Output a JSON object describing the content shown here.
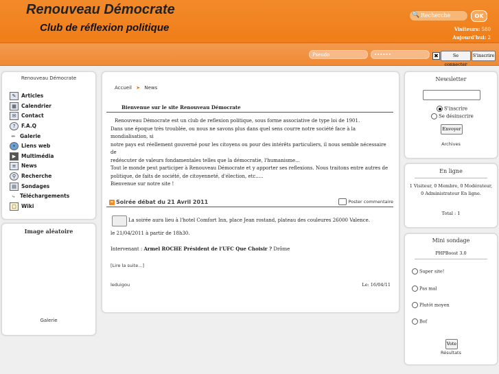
{
  "header": {
    "title": "Renouveau Démocrate",
    "subtitle": "Club de réflexion politique",
    "search_placeholder": "Recherche",
    "ok_label": "OK",
    "visitors_label": "Visiteurs:",
    "visitors_value": "580",
    "today_label": "Aujourd'hui:",
    "today_value": "2"
  },
  "login": {
    "pseudo_placeholder": "Pseudo",
    "password_value": "••••••",
    "connect_label": "Se connecter",
    "register_label": "S'inscrire"
  },
  "left": {
    "title": "Renouveau Démocrate",
    "menu": [
      {
        "label": "Articles",
        "icon": "articles-icon"
      },
      {
        "label": "Calendrier",
        "icon": "calendar-icon"
      },
      {
        "label": "Contact",
        "icon": "contact-icon"
      },
      {
        "label": "F.A.Q",
        "icon": "faq-icon"
      },
      {
        "label": "Galerie",
        "icon": "gallery-icon"
      },
      {
        "label": "Liens web",
        "icon": "web-links-icon"
      },
      {
        "label": "Multimédia",
        "icon": "multimedia-icon"
      },
      {
        "label": "News",
        "icon": "news-icon"
      },
      {
        "label": "Recherche",
        "icon": "search-icon"
      },
      {
        "label": "Sondages",
        "icon": "polls-icon"
      },
      {
        "label": "Téléchargements",
        "icon": "downloads-icon"
      },
      {
        "label": "Wiki",
        "icon": "wiki-icon"
      }
    ],
    "random_image_title": "Image aléatoire",
    "gallery_link": "Galerie"
  },
  "main": {
    "breadcrumb": [
      "Accueil",
      "News"
    ],
    "welcome_title": "Bienvenue sur le site Renouveau Démocrate",
    "welcome_lines": [
      "Renouveau Démocrate est un club de reflexion politique, sous forme associative de type loi de 1901.",
      "Dans une époque très troublée, ou nous ne savons plus dans quel sens courre notre société face à la mondialisation, si",
      "notre pays est réellement gouverné pour les citoyens ou pour des intérêts particuliers, il nous semble nécessaire de",
      "redéscuter de valeurs fondamentales telles que la démocratie, l'humanisme...",
      "Tout le monde peut participer à Renouveau Démocrate et y apporter ses reflexions. Nous traitons entre autres de",
      "politique, de faits de société, de citoyenneté, d'élection, etc.....",
      "Bienvenue sur notre site !"
    ],
    "news": {
      "title": "Soirée débat du 21 Avril 2011",
      "post_comment": "Poster commentaire",
      "line1": "La soirée aura lieu à l'hotel Comfort Inn, place Jean rostand, plateau des couleures 26000 Valence.",
      "line2": "le 21/04/2011 à partir de 18h30.",
      "speaker_prefix": "Intervenant : ",
      "speaker_name": "Armel ROCHE Président de l'UFC Que Choisir ?",
      "speaker_suffix": " Drôme",
      "read_more": "[Lire la suite...]",
      "author": "leduigou",
      "date": "Le: 16/04/11"
    }
  },
  "right": {
    "newsletter": {
      "title": "Newsletter",
      "subscribe": "S'inscrire",
      "unsubscribe": "Se désinscrire",
      "send": "Envoyer",
      "archives": "Archives"
    },
    "online": {
      "title": "En ligne",
      "stats": "1 Visiteur, 0 Membre, 0 Modérateur, 0 Administrateur En ligne.",
      "total": "Total : 1"
    },
    "poll": {
      "title": "Mini sondage",
      "question": "PHPBoost 3.0",
      "options": [
        "Super site!",
        "Pas mal",
        "Plutôt moyen",
        "Bof"
      ],
      "vote": "Vote",
      "results": "Résultats"
    }
  }
}
